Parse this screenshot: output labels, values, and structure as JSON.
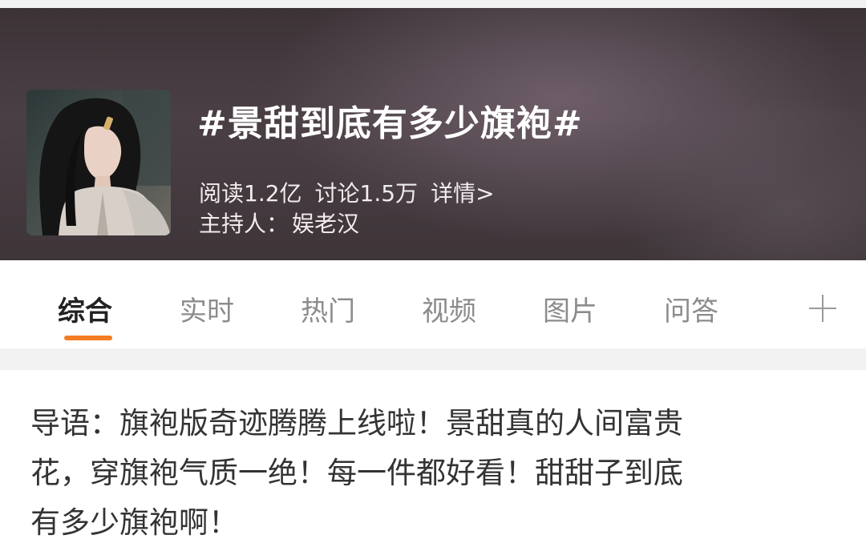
{
  "header": {
    "topic_title": "#景甜到底有多少旗袍#",
    "reads": "阅读1.2亿",
    "discussions": "讨论1.5万",
    "details_link": "详情>",
    "host_label": "主持人：",
    "host_name": "娱老汉"
  },
  "tabs": {
    "items": [
      {
        "label": "综合",
        "active": true
      },
      {
        "label": "实时",
        "active": false
      },
      {
        "label": "热门",
        "active": false
      },
      {
        "label": "视频",
        "active": false
      },
      {
        "label": "图片",
        "active": false
      },
      {
        "label": "问答",
        "active": false
      }
    ],
    "accent_color": "#f57c22",
    "add_icon": "plus-icon"
  },
  "intro": {
    "line1": "导语：旗袍版奇迹腾腾上线啦！景甜真的人间富贵",
    "line2": "花，穿旗袍气质一绝！每一件都好看！甜甜子到底",
    "line3": "有多少旗袍啊！"
  }
}
